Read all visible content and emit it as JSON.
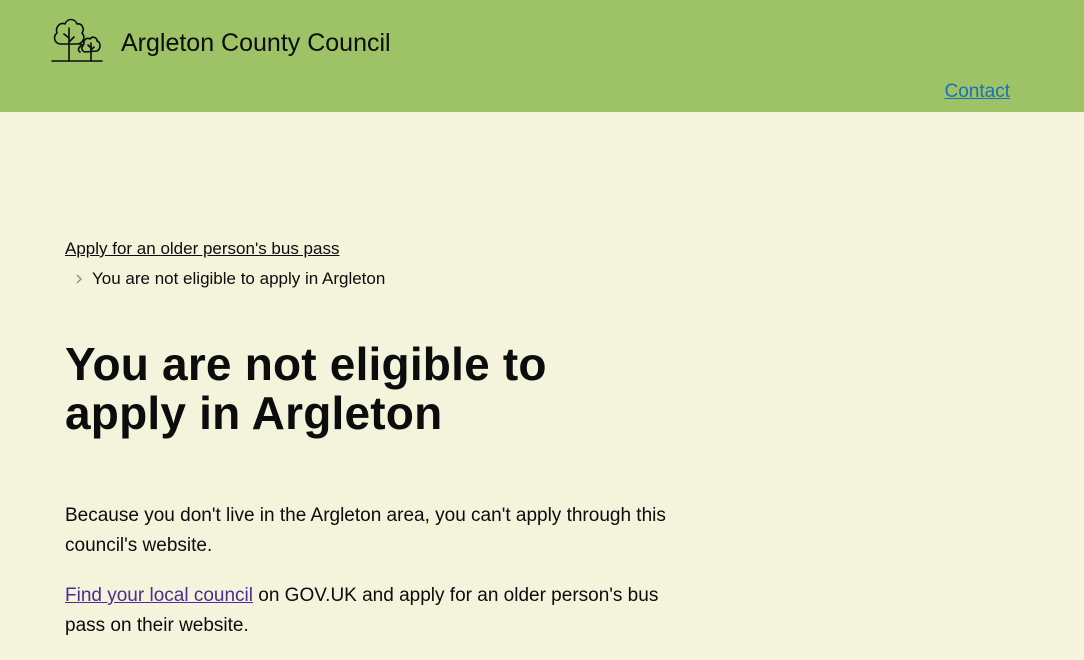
{
  "header": {
    "site_title": "Argleton County Council",
    "logo_icon": "trees-logo-icon",
    "background_color": "#9dc366",
    "contact_label": "Contact"
  },
  "breadcrumb": {
    "parent_label": "Apply for an older person's bus pass",
    "current_label": "You are not eligible to apply in Argleton"
  },
  "main": {
    "title": "You are not eligible to apply in Argleton",
    "paragraph_1": "Because you don't live in the Argleton area, you can't apply through this council's website.",
    "paragraph_2_link": "Find your local council",
    "paragraph_2_rest": " on GOV.UK and apply for an older person's bus pass on their website."
  },
  "colors": {
    "page_background": "#f4f4dc",
    "link": "#1d70b8",
    "visited_link": "#4c2c92",
    "text": "#0b0c0c"
  }
}
